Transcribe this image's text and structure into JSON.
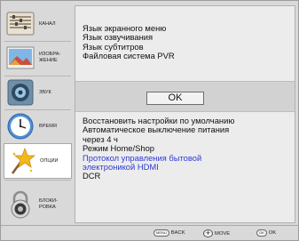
{
  "sidebar": {
    "items": [
      {
        "label": "КАНАЛ",
        "icon": "channel-icon"
      },
      {
        "label": "ИЗОБРА-\nЖЕНИЕ",
        "icon": "picture-icon"
      },
      {
        "label": "ЗВУК",
        "icon": "speaker-icon"
      },
      {
        "label": "ВРЕМЯ",
        "icon": "clock-icon"
      },
      {
        "label": "ОПЦИИ",
        "icon": "star-wand-icon"
      },
      {
        "label": "БЛОКИ-\nРОВКА",
        "icon": "padlock-icon"
      }
    ]
  },
  "main": {
    "top_items": [
      "Язык экранного меню",
      "Язык озвучивания",
      "Язык субтитров",
      "Файловая система PVR"
    ],
    "ok_label": "OK",
    "bottom_items": [
      "Восстановить настройки по умолчанию",
      "Автоматическое выключение питания",
      "через 4 ч",
      "Режим Home/Shop",
      "Протокол управления бытовой",
      "электроникой HDMI",
      "DCR"
    ]
  },
  "hints": {
    "back": {
      "key": "MENU",
      "label": "BACK"
    },
    "move": {
      "key": "+",
      "label": "MOVE"
    },
    "ok": {
      "key": "OK",
      "label": "OK"
    }
  },
  "colors": {
    "highlight_text": "#2d3bd6",
    "active_tab": "#ffffff"
  }
}
